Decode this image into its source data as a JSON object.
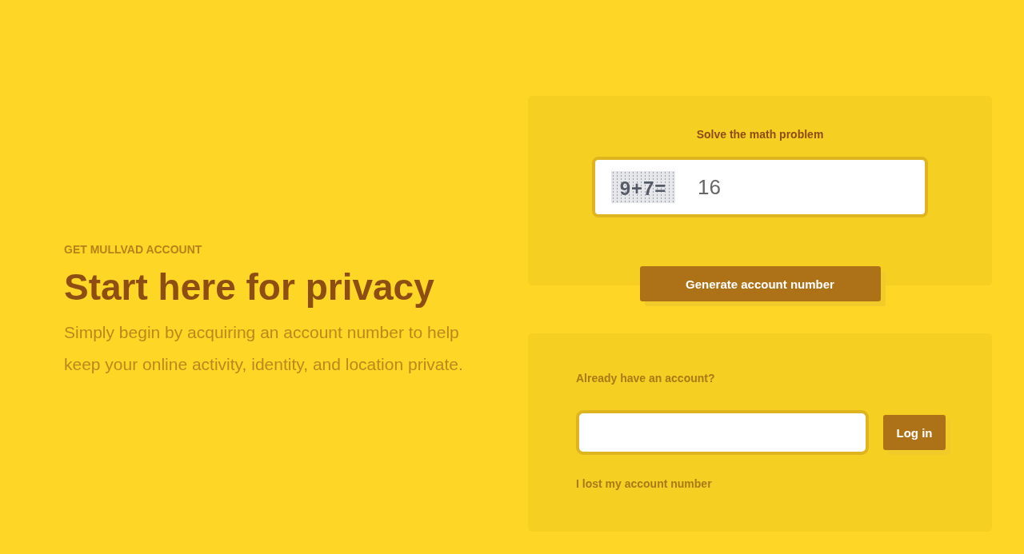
{
  "intro": {
    "eyebrow": "GET MULLVAD ACCOUNT",
    "title": "Start here for privacy",
    "description": "Simply begin by acquiring an account number to help keep your online activity, identity, and location private."
  },
  "generate_card": {
    "label": "Solve the math problem",
    "captcha": "9+7=",
    "answer": "16",
    "button": "Generate account number"
  },
  "login_card": {
    "label": "Already have an account?",
    "button": "Log in",
    "lost_link": "I lost my account number"
  }
}
